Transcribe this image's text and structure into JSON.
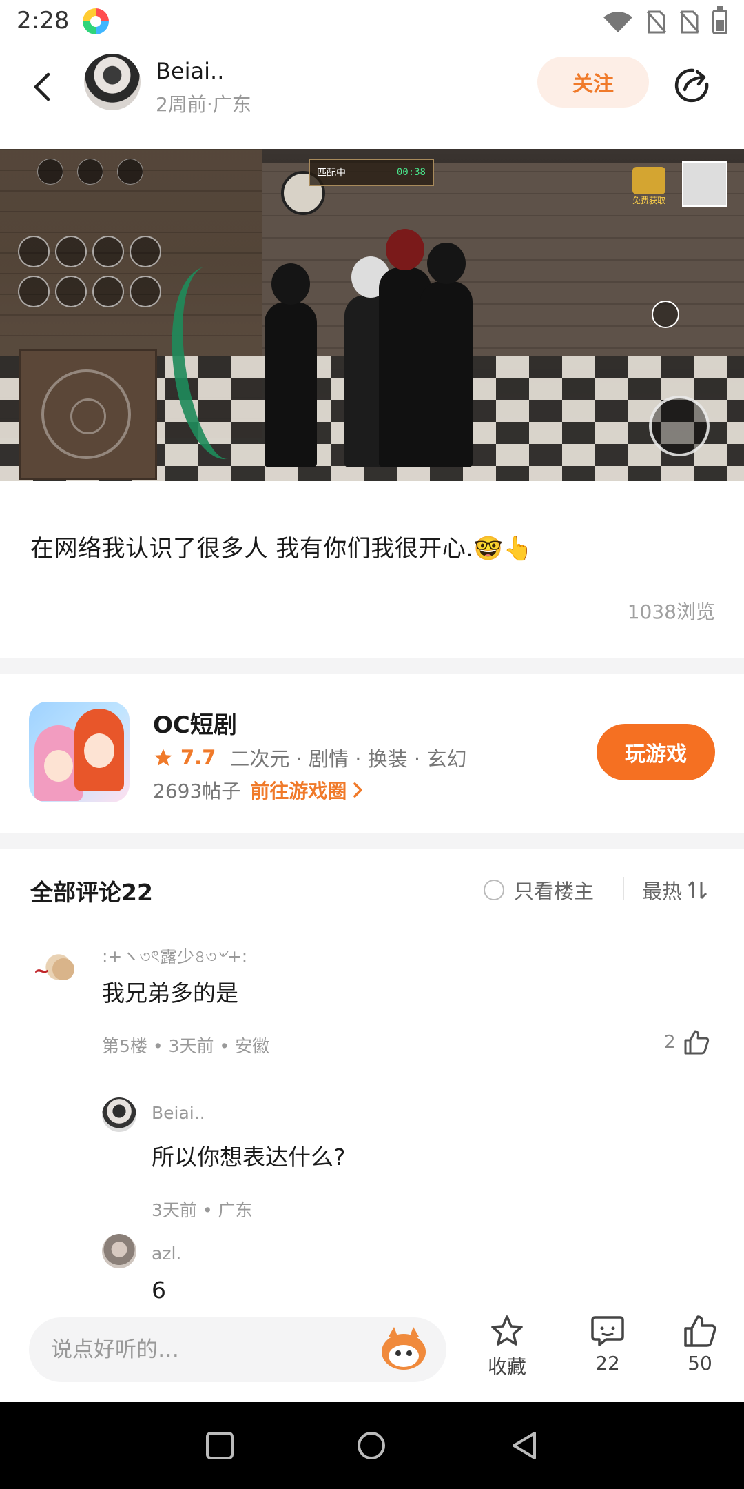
{
  "status_bar": {
    "time": "2:28"
  },
  "header": {
    "username": "Beiai..",
    "meta": "2周前·广东",
    "follow_label": "关注"
  },
  "post": {
    "text": "在网络我认识了很多人 我有你们我很开心.🤓👆",
    "views": "1038浏览",
    "image_overlay": {
      "match_label": "匹配中",
      "match_time": "00:38",
      "reward_label": "免费获取"
    }
  },
  "game_card": {
    "title": "OC短剧",
    "rating": "7.7",
    "tags": "二次元 · 剧情 · 换装 · 玄幻",
    "posts_count": "2693帖子",
    "goto_label": "前往游戏圈",
    "play_label": "玩游戏"
  },
  "comments_section": {
    "title": "全部评论22",
    "only_op_label": "只看楼主",
    "sort_label": "最热"
  },
  "comments": [
    {
      "name": ":+ヽ৩ৎ露少৪৩৺+:",
      "text": "我兄弟多的是",
      "meta": "第5楼 • 3天前 • 安徽",
      "likes": "2"
    },
    {
      "name": "Beiai..",
      "text": "所以你想表达什么?",
      "meta": "3天前 • 广东"
    },
    {
      "name": "azl.",
      "text": "6"
    }
  ],
  "bottom_bar": {
    "input_placeholder": "说点好听的…",
    "favorite_label": "收藏",
    "comment_count": "22",
    "like_count": "50"
  },
  "colors": {
    "accent": "#f57022",
    "follow_bg": "#fdeee6",
    "muted_text": "#999999"
  }
}
